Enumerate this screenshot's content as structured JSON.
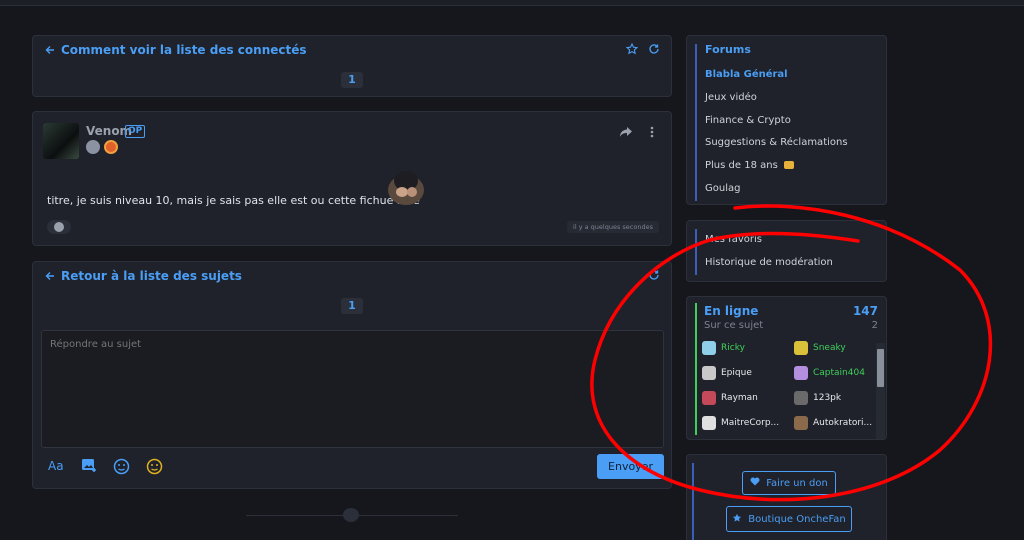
{
  "topic": {
    "title": "Comment voir la liste des connectés",
    "page": "1"
  },
  "post": {
    "author": "Venom",
    "op_badge": "OP",
    "text": "titre, je suis niveau 10, mais je sais pas elle est ou cette fichue liste",
    "time": "il y a quelques secondes"
  },
  "reply": {
    "back_label": "Retour à la liste des sujets",
    "page": "1",
    "placeholder": "Répondre au sujet",
    "format_label": "Aa",
    "send_label": "Envoyer"
  },
  "forums": {
    "title": "Forums",
    "items": [
      "Blabla Général",
      "Jeux vidéo",
      "Finance & Crypto",
      "Suggestions & Réclamations",
      "Plus de 18 ans",
      "Goulag"
    ]
  },
  "links": {
    "items": [
      "Mes favoris",
      "Historique de modération"
    ]
  },
  "online": {
    "title": "En ligne",
    "count": "147",
    "subtitle": "Sur ce sujet",
    "subcount": "2",
    "users": [
      {
        "name": "Ricky",
        "color": "#3ecf5a"
      },
      {
        "name": "Sneaky",
        "color": "#3ecf5a"
      },
      {
        "name": "Epique",
        "color": "#e6e8ec"
      },
      {
        "name": "Captain404",
        "color": "#3ecf5a"
      },
      {
        "name": "Rayman",
        "color": "#e6e8ec"
      },
      {
        "name": "123pk",
        "color": "#e6e8ec"
      },
      {
        "name": "MaitreCorp...",
        "color": "#e6e8ec"
      },
      {
        "name": "Autokratori...",
        "color": "#e6e8ec"
      }
    ]
  },
  "actions": {
    "donate_label": "Faire un don",
    "shop_label": "Boutique OncheFan"
  },
  "colors": {
    "accent": "#4a9ef5",
    "annotation": "#ff0000",
    "online_green": "#3ecf5a"
  }
}
